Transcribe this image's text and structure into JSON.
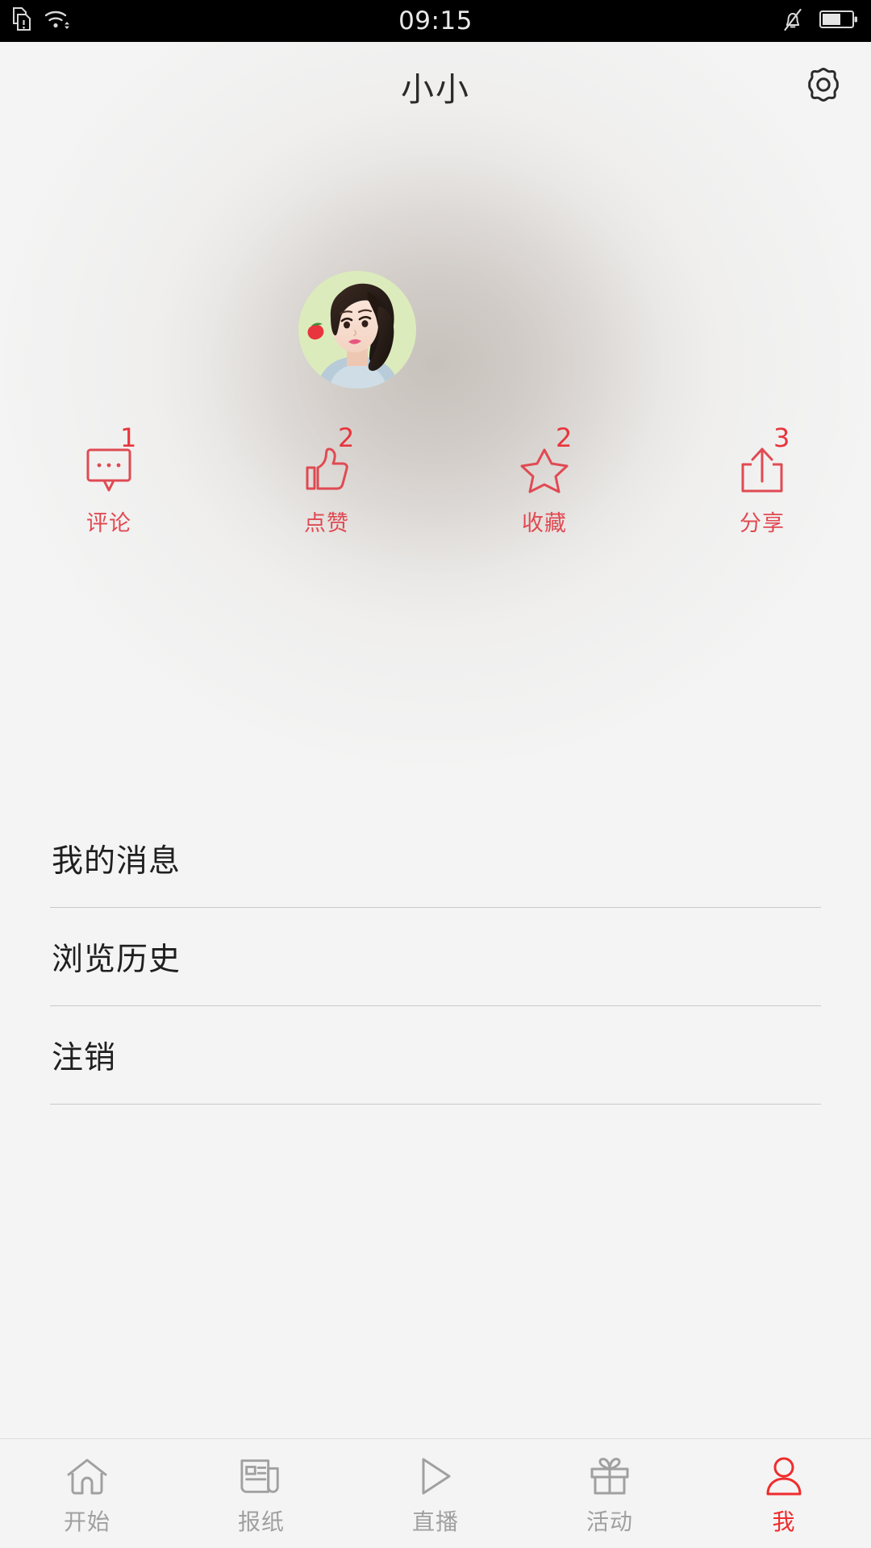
{
  "status_bar": {
    "time": "09:15",
    "left_icons": [
      "sim-warning-icon",
      "wifi-icon"
    ],
    "right_icons": [
      "bell-muted-icon",
      "battery-icon"
    ],
    "battery_level_percent": 60,
    "background_color": "#000000",
    "foreground_color": "#e8e8e8"
  },
  "header": {
    "title": "小小",
    "settings_icon": "gear-icon"
  },
  "profile": {
    "avatar_alt": "user-avatar-photo",
    "avatar_background_color": "#d6e6b4"
  },
  "stats": {
    "accent_color": "#e04a52",
    "count_color": "#e8353c",
    "items": [
      {
        "icon": "comment-bubble-icon",
        "count": "1",
        "label": "评论"
      },
      {
        "icon": "thumbs-up-icon",
        "count": "2",
        "label": "点赞"
      },
      {
        "icon": "star-icon",
        "count": "2",
        "label": "收藏"
      },
      {
        "icon": "share-upload-icon",
        "count": "3",
        "label": "分享"
      }
    ]
  },
  "menu": {
    "items": [
      {
        "label": "我的消息"
      },
      {
        "label": "浏览历史"
      },
      {
        "label": "注销"
      }
    ]
  },
  "bottom_nav": {
    "active_color": "#ef2d2d",
    "inactive_color": "#a0a0a0",
    "items": [
      {
        "icon": "home-icon",
        "label": "开始",
        "active": false
      },
      {
        "icon": "newspaper-icon",
        "label": "报纸",
        "active": false
      },
      {
        "icon": "play-icon",
        "label": "直播",
        "active": false
      },
      {
        "icon": "gift-icon",
        "label": "活动",
        "active": false
      },
      {
        "icon": "person-icon",
        "label": "我",
        "active": true
      }
    ]
  }
}
